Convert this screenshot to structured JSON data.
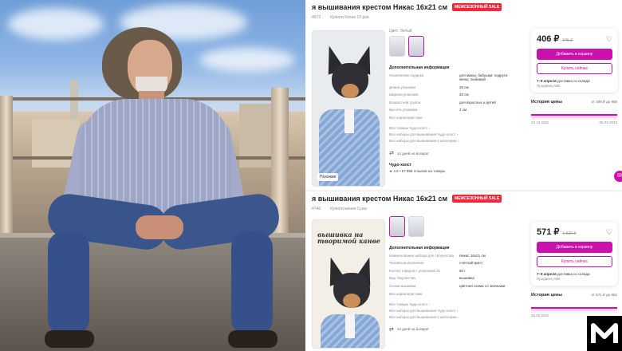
{
  "panels": [
    {
      "title": "я вышивания крестом Никас 16x21 см",
      "sale_badge": "МЕЖСЕЗОННЫЙ SALE",
      "meta": [
        "4073",
        "Купили более 10 раз"
      ],
      "image_caption": "Похожие",
      "color_label": "Цвет: белый",
      "info_title": "Дополнительная информация",
      "specs": [
        {
          "k": "Назначение подарка",
          "v": "для мамы; бабушки; подруги; жены; любимой"
        },
        {
          "k": "Длина упаковки",
          "v": "20 см"
        },
        {
          "k": "Ширина упаковки",
          "v": "20 см"
        },
        {
          "k": "Возрастная группа",
          "v": "для взрослых и детей"
        },
        {
          "k": "Высота упаковки",
          "v": "2 см"
        }
      ],
      "all_chars": "Все характеристики",
      "links": [
        "Все товары Чудо-холст ›",
        "Все наборы для вышивания Чудо-холст ›",
        "Все наборы для вышивания в категории ›"
      ],
      "returns": "14 дней на возврат",
      "brand": "Чудо-холст",
      "rating": "4.5 • 57 998 отзывов на товары",
      "price": "406 ₽",
      "old_price": "945 ₽",
      "cart_button": "Добавить в корзину",
      "buy_button": "Купить сейчас",
      "delivery_bold": "7–9 апреля",
      "delivery_rest": "доставка со склада",
      "seller": "Продавец WB",
      "history_title": "История цены",
      "history_delta": "от 406 ₽ до 956",
      "dates": [
        "22.10.2022",
        "06.04.2023"
      ]
    },
    {
      "title": "я вышивания крестом Никас 16x21 см",
      "sale_badge": "МЕЖСЕЗОННЫЙ SALE",
      "meta": [
        "4746",
        "Купили менее 5 раз"
      ],
      "canvas_text": "вышивка на творимой канве",
      "info_title": "Дополнительная информация",
      "specs": [
        {
          "k": "Наименование набора для творчества",
          "v": "Никас 16x21 см"
        },
        {
          "k": "Техника выполнения",
          "v": "счетный крест"
        },
        {
          "k": "Кол-во товаров с упаковкой 21",
          "v": "50 г"
        },
        {
          "k": "Вид творчества",
          "v": "вышивка"
        },
        {
          "k": "Схема вышивки",
          "v": "цветная схема со значками"
        }
      ],
      "all_chars": "Все характеристики",
      "links": [
        "Все товары Чудо-холст ›",
        "Все наборы для вышивания Чудо-холст ›",
        "Все наборы для вышивания в категории ›"
      ],
      "returns": "14 дней на возврат",
      "price": "571 ₽",
      "old_price": "1 530 ₽",
      "cart_button": "Добавить в корзину",
      "buy_button": "Купить сейчас",
      "delivery_bold": "7–9 апреля",
      "delivery_rest": "доставка со склада",
      "seller": "Продавец WB",
      "history_title": "История цены",
      "history_delta": "от 571 ₽ до 962",
      "dates": [
        "28.03.2022",
        ""
      ]
    }
  ],
  "logo_text": "M",
  "colors": {
    "accent": "#cb11ab",
    "sale": "#f0283c"
  },
  "icons": [
    "heart-icon",
    "return-icon",
    "star-icon",
    "chat-icon"
  ]
}
